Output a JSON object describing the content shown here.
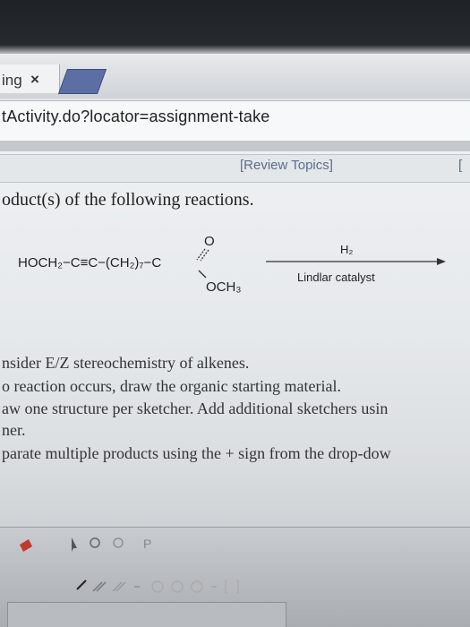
{
  "browser": {
    "tab_title": "ing",
    "tab_close": "×",
    "url": "tActivity.do?locator=assignment-take"
  },
  "page": {
    "review_topics": "[Review Topics]",
    "review_right": "[",
    "question": "oduct(s) of the following reactions.",
    "reaction": {
      "reactant_main": "HOCH₂−C≡C−(CH₂)₇−C",
      "carbonyl_o": "O",
      "ester_group": "OCH₃",
      "reagent_top": "H₂",
      "reagent_bottom": "Lindlar catalyst"
    },
    "instructions": [
      "nsider E/Z stereochemistry of alkenes.",
      "o reaction occurs, draw the organic starting material.",
      "aw one structure per sketcher. Add additional sketchers usin",
      "ner.",
      "parate multiple products using the + sign from the drop-dow"
    ]
  },
  "colors": {
    "link": "#5a6e8c",
    "new_tab": "#5c6fa4",
    "tool_red": "#c0392b"
  }
}
